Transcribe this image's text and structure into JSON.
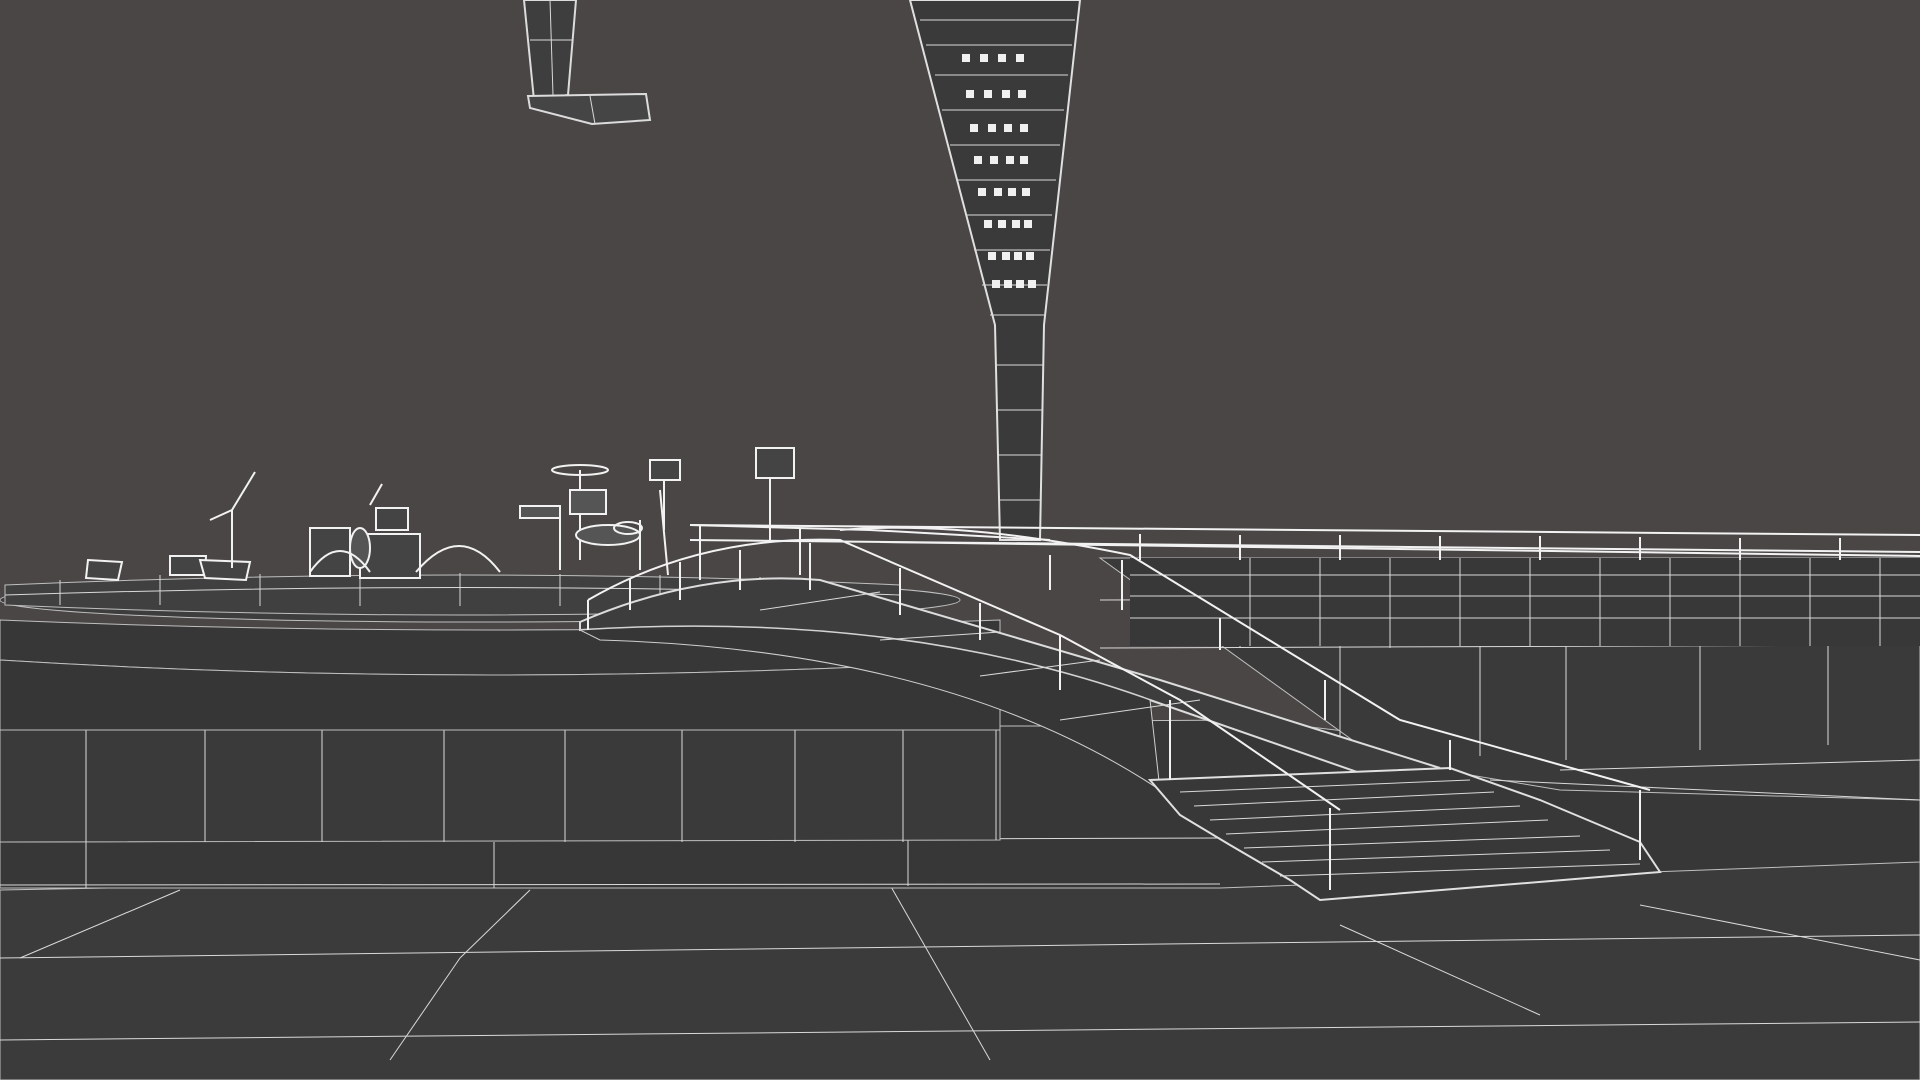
{
  "scene": {
    "kind": "3D wireframe render of concert stage with arched footbridge",
    "colors": {
      "background": "#4a4645",
      "surface": "#3c3c3c",
      "surface_dark": "#353535",
      "wire": "#d9d9d9",
      "wire_bright": "#f4f4f4"
    },
    "objects": [
      "rigging-truss",
      "line-array-tower",
      "round-stage-platform",
      "drum-kit",
      "microphone-stand",
      "guitar",
      "speaker-stacks",
      "arched-footbridge",
      "stairs",
      "handrails",
      "railing-upper-deck",
      "tiered-floor-rings",
      "ground-plane-tiles"
    ]
  }
}
